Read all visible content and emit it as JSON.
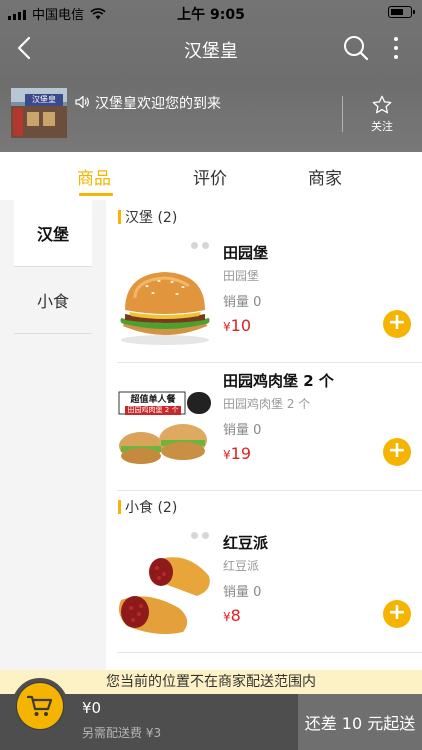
{
  "status_bar": {
    "carrier": "中国电信",
    "time": "上午 9:05"
  },
  "nav": {
    "title": "汉堡皇"
  },
  "shop": {
    "thumb_sign": "汉堡皇",
    "notice": "汉堡皇欢迎您的到来",
    "follow_label": "关注"
  },
  "tabs": [
    {
      "label": "商品",
      "active": true
    },
    {
      "label": "评价",
      "active": false
    },
    {
      "label": "商家",
      "active": false
    }
  ],
  "categories": [
    {
      "label": "汉堡",
      "active": true
    },
    {
      "label": "小食",
      "active": false
    }
  ],
  "sections": [
    {
      "title": "汉堡 (2)",
      "items": [
        {
          "name": "田园堡",
          "desc": "田园堡",
          "sales": "销量 0",
          "price_symbol": "¥",
          "price": "10"
        },
        {
          "name": "田园鸡肉堡 2 个",
          "desc": "田园鸡肉堡 2 个",
          "sales": "销量 0",
          "price_symbol": "¥",
          "price": "19",
          "banner_text": "超值单人餐",
          "banner_sub": "田园鸡肉堡 2 个"
        }
      ]
    },
    {
      "title": "小食 (2)",
      "items": [
        {
          "name": "红豆派",
          "desc": "红豆派",
          "sales": "销量 0",
          "price_symbol": "¥",
          "price": "8"
        }
      ]
    }
  ],
  "bottom": {
    "warning": "您当前的位置不在商家配送范围内",
    "total": "¥0",
    "delivery_fee": "另需配送费 ¥3",
    "checkout": "还差 10 元起送"
  },
  "colors": {
    "accent": "#f5b400",
    "price": "#e02020",
    "header_bg": "#707070",
    "bottom_bg": "#4e4e4e"
  }
}
